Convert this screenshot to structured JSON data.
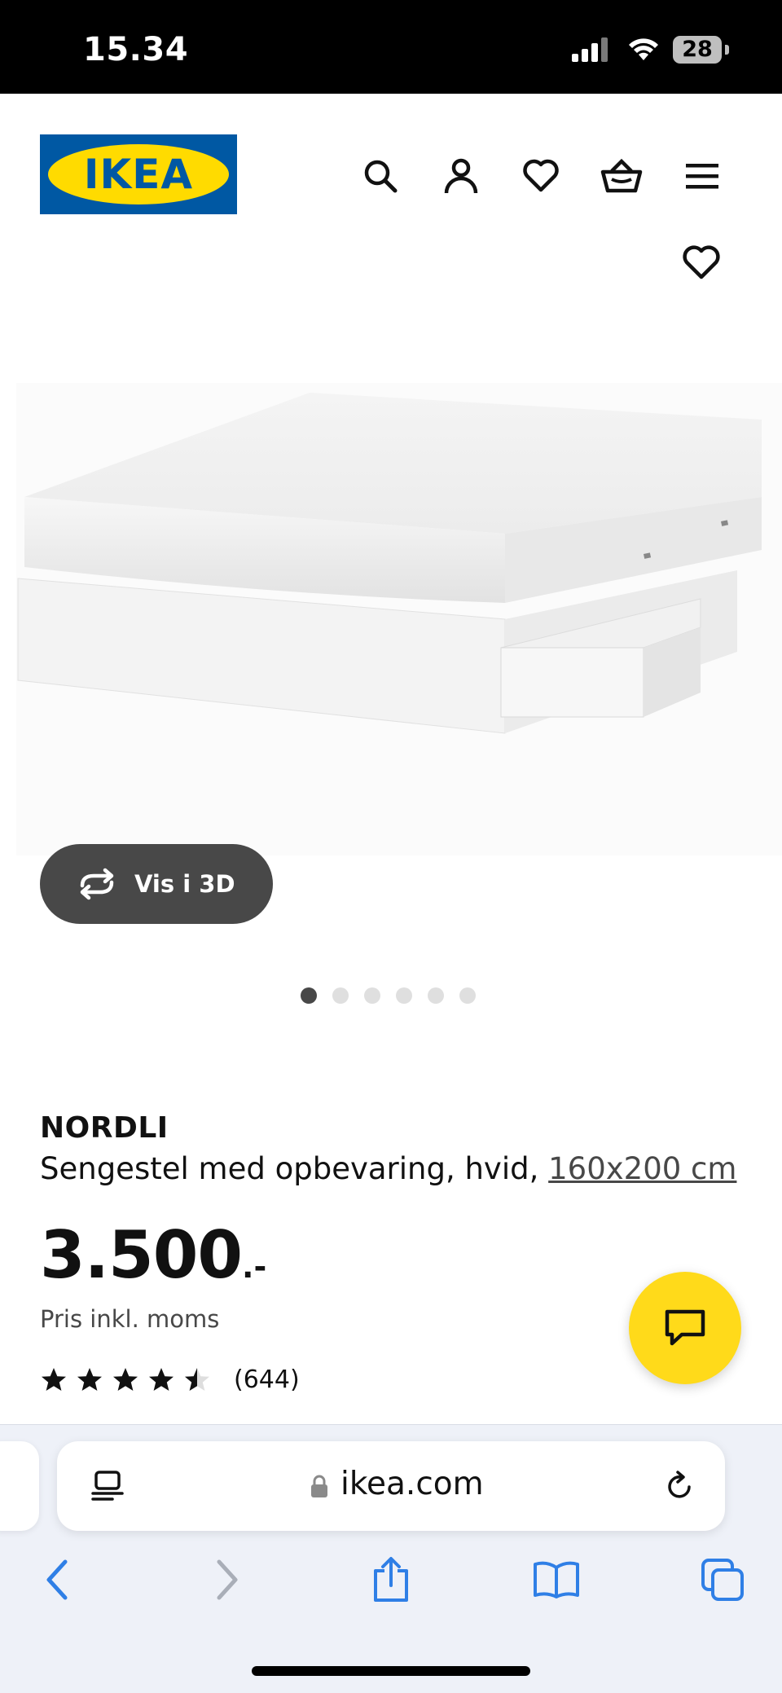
{
  "status_bar": {
    "time": "15.34",
    "battery": "28"
  },
  "header": {
    "logo_text": "IKEA",
    "icons": [
      "search-icon",
      "account-icon",
      "favourites-icon",
      "basket-icon",
      "menu-icon"
    ]
  },
  "gallery": {
    "view_3d_label": "Vis i 3D",
    "image_count": 6,
    "active_index": 0
  },
  "product": {
    "name": "NORDLI",
    "description": "Sengestel med opbevaring, hvid,",
    "size_link": "160x200 cm",
    "price": "3.500",
    "price_suffix": ".-",
    "vat_note": "Pris inkl. moms",
    "rating": 4.5,
    "rating_max": 5,
    "review_count": "(644)"
  },
  "browser": {
    "url": "ikea.com"
  },
  "colors": {
    "ikea_blue": "#0058a3",
    "ikea_yellow": "#ffdb00",
    "chat_button": "#ffda1a",
    "safari_blue": "#2f7fe6"
  }
}
